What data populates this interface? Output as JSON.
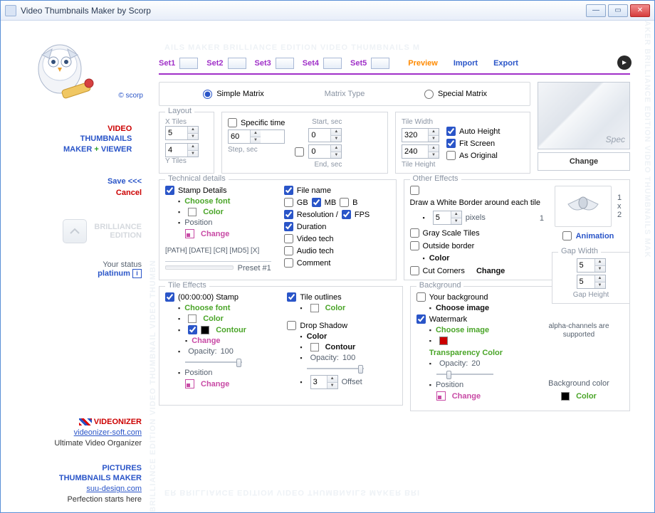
{
  "window": {
    "title": "Video Thumbnails Maker by Scorp"
  },
  "watermark": "AILS MAKER BRILLIANCE EDITION VIDEO THUMBNAILS M",
  "watermark_side": "BRILLIANCE EDITION VIDEO THUMBNAIL VIDEO THUMBN",
  "watermark_side_r": "AKER BRILLIANCE EDITION VIDEO THUMBNAILS MAK",
  "watermark_bottom": "ER BRILLIANCE EDITION VIDEO THUMBNAILS MAKER BRI",
  "sidebar": {
    "scorp": "© scorp",
    "brand_video": "VIDEO",
    "brand_thumb": "THUMBNAILS",
    "brand_maker": "MAKER",
    "brand_plus": "+",
    "brand_viewer": "VIEWER",
    "save": "Save <<<",
    "cancel": "Cancel",
    "edition1": "BRILLIANCE",
    "edition2": "EDITION",
    "status_lbl": "Your status",
    "status_val": "platinum",
    "videonizer": "VIDEONIZER",
    "videonizer_link": "videonizer-soft.com",
    "videonizer_tag": "Ultimate Video Organizer",
    "ptm1": "PICTURES",
    "ptm2": "THUMBNAILS MAKER",
    "ptm_link": "suu-design.com",
    "ptm_tag": "Perfection starts here"
  },
  "tabs": {
    "sets": [
      "Set1",
      "Set2",
      "Set3",
      "Set4",
      "Set5"
    ],
    "preview": "Preview",
    "import": "Import",
    "export": "Export"
  },
  "matrix": {
    "simple": "Simple Matrix",
    "type": "Matrix Type",
    "special": "Special Matrix"
  },
  "layout": {
    "legend": "Layout",
    "xtiles_lbl": "X Tiles",
    "ytiles_lbl": "Y Tiles",
    "xtiles": "5",
    "ytiles": "4",
    "specific": "Specific time",
    "step": "60",
    "step_lbl": "Step, sec",
    "start_lbl": "Start, sec",
    "end_lbl": "End, sec",
    "start": "0",
    "end": "0",
    "tilew_lbl": "Tile Width",
    "tileh_lbl": "Tile Height",
    "tilew": "320",
    "tileh": "240",
    "autoheight": "Auto Height",
    "fitscreen": "Fit Screen",
    "asoriginal": "As Original"
  },
  "preview": {
    "spec": "Spec",
    "change": "Change"
  },
  "tech": {
    "legend": "Technical  details",
    "stamp": "Stamp Details",
    "choosefont": "Choose font",
    "color": "Color",
    "position": "Position",
    "change": "Change",
    "tokens": "[PATH] [DATE] [CR] [MD5] [X]",
    "preset": "Preset #1",
    "filename": "File name",
    "gb": "GB",
    "mb": "MB",
    "b": "B",
    "resolution": "Resolution /",
    "fps": "FPS",
    "duration": "Duration",
    "videotech": "Video tech",
    "audiotech": "Audio tech",
    "comment": "Comment"
  },
  "other": {
    "legend": "Other Effects",
    "whiteborder": "Draw a White Border around each tile",
    "pixels": "pixels",
    "px": "5",
    "grayscale": "Gray Scale Tiles",
    "outside": "Outside border",
    "color": "Color",
    "cutcorners": "Cut Corners",
    "change": "Change",
    "one": "1",
    "x": "x",
    "two": "2",
    "animation": "Animation"
  },
  "gap": {
    "legend": "Gap Width",
    "w": "5",
    "h": "5",
    "heightlbl": "Gap Height"
  },
  "tile": {
    "legend": "Tile Effects",
    "timestamp": "(00:00:00) Stamp",
    "choosefont": "Choose font",
    "color": "Color",
    "contour": "Contour",
    "change": "Change",
    "opacity": "Opacity:",
    "opv": "100",
    "position": "Position",
    "outlines": "Tile outlines",
    "dropshadow": "Drop Shadow",
    "offset_lbl": "Offset",
    "offset": "3"
  },
  "bg": {
    "legend": "Background",
    "yourbg": "Your background",
    "chooseimg": "Choose image",
    "watermark": "Watermark",
    "transp": "Transparency Color",
    "opacity": "Opacity:",
    "opv": "20",
    "position": "Position",
    "change": "Change",
    "alpha": "alpha-channels are supported",
    "bgcolor": "Background color",
    "color": "Color"
  }
}
